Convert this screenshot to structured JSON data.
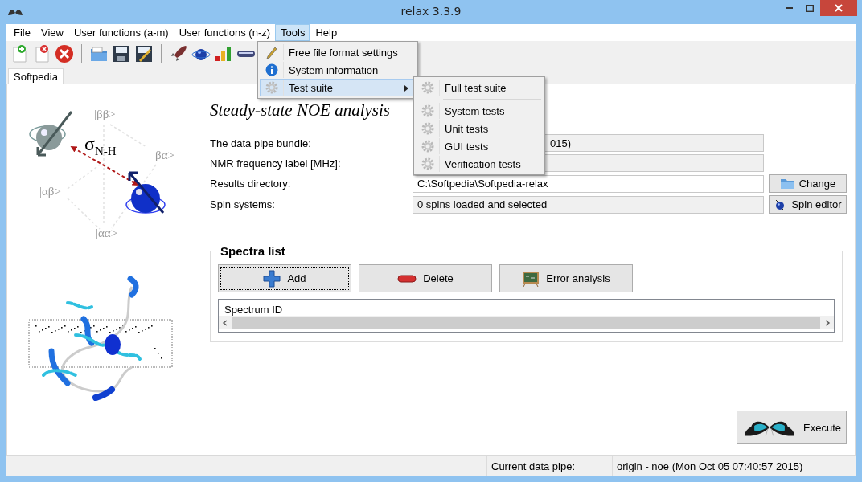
{
  "window": {
    "title": "relax 3.3.9"
  },
  "menu_bar": [
    {
      "label": "File",
      "selected": false
    },
    {
      "label": "View",
      "selected": false
    },
    {
      "label": "User functions (a-m)",
      "selected": false
    },
    {
      "label": "User functions (n-z)",
      "selected": false
    },
    {
      "label": "Tools",
      "selected": true
    },
    {
      "label": "Help",
      "selected": false
    }
  ],
  "tabs": [
    {
      "label": "Softpedia",
      "selected": true
    }
  ],
  "open_menu": {
    "items": [
      {
        "label": "Free file format settings",
        "selected": false,
        "has_submenu": false
      },
      {
        "label": "System information",
        "selected": false,
        "has_submenu": false
      },
      {
        "label": "Test suite",
        "selected": true,
        "has_submenu": true
      }
    ],
    "submenu": [
      {
        "label": "Full test suite",
        "separator_after": true
      },
      {
        "label": "System tests",
        "separator_after": false
      },
      {
        "label": "Unit tests",
        "separator_after": false
      },
      {
        "label": "GUI tests",
        "separator_after": false
      },
      {
        "label": "Verification tests",
        "separator_after": false
      }
    ]
  },
  "diagram": {
    "coupling": "σ$_{N-H}$",
    "states": [
      "|ββ>",
      "|βα>",
      "|αβ>",
      "|αα>"
    ]
  },
  "analysis": {
    "title": "Steady-state NOE analysis",
    "fields": [
      {
        "label": "The data pipe bundle:",
        "value": "015)",
        "partly_hidden": true
      },
      {
        "label": "NMR frequency label [MHz]:"
      },
      {
        "label": "Results directory:",
        "value": "C:\\Softpedia\\Softpedia-relax",
        "partly_hidden": false,
        "button": "Change"
      },
      {
        "label": "Spin systems:",
        "value": "0 spins loaded and selected",
        "partly_hidden": false,
        "button": "Spin editor"
      }
    ],
    "spectra": {
      "title": "Spectra list",
      "buttons": [
        {
          "label": "Add",
          "focused": true
        },
        {
          "label": "Delete",
          "focused": false
        },
        {
          "label": "Error analysis",
          "focused": false
        }
      ],
      "columns": [
        "Spectrum ID"
      ]
    },
    "execute": "Execute"
  },
  "status_bar": {
    "label": "Current data pipe:",
    "value": "origin - noe (Mon Oct 05 07:40:57 2015)"
  }
}
